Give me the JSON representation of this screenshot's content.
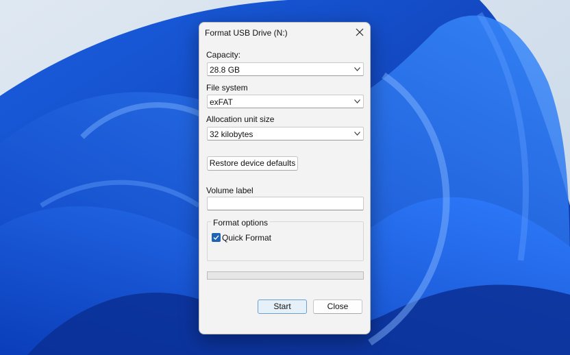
{
  "dialog": {
    "title": "Format USB Drive (N:)",
    "capacity": {
      "label": "Capacity:",
      "value": "28.8 GB"
    },
    "file_system": {
      "label": "File system",
      "value": "exFAT"
    },
    "allocation": {
      "label": "Allocation unit size",
      "value": "32 kilobytes"
    },
    "restore_button": "Restore device defaults",
    "volume_label": {
      "label": "Volume label",
      "value": ""
    },
    "format_options": {
      "title": "Format options",
      "quick_format": {
        "label": "Quick Format",
        "checked": true
      }
    },
    "progress": 0,
    "start_button": "Start",
    "close_button": "Close"
  },
  "icons": {
    "close": "close-icon",
    "chevron": "chevron-down-icon",
    "check": "checkmark-icon"
  },
  "colors": {
    "accent": "#1f64b4",
    "dialog_bg": "#f3f3f3",
    "wallpaper_bg": "#cfdcea"
  }
}
